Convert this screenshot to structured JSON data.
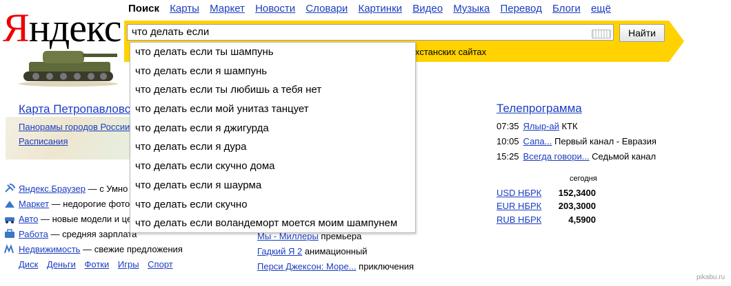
{
  "logo": {
    "first": "Я",
    "rest": "ндекс"
  },
  "nav": [
    "Поиск",
    "Карты",
    "Маркет",
    "Новости",
    "Словари",
    "Картинки",
    "Видео",
    "Музыка",
    "Перевод",
    "Блоги",
    "ещё"
  ],
  "search": {
    "value": "что делать если",
    "button": "Найти",
    "partial_hint": "хстанских сайтах"
  },
  "suggestions": [
    "что делать если ты шампунь",
    "что делать если я шампунь",
    "что делать если ты любишь а тебя нет",
    "что делать если мой унитаз танцует",
    "что делать если я джигурда",
    "что делать если я дура",
    "что делать если скучно дома",
    "что делать если я шаурма",
    "что делать если скучно",
    "что делать если воландеморт моется моим шампунем"
  ],
  "map": {
    "title": "Карта Петропавловс",
    "panoramas": "Панорамы городов России",
    "schedules": "Расписания"
  },
  "services": [
    {
      "icon": "browser-icon",
      "link": "Яндекс.Браузер",
      "text": "— с Умно"
    },
    {
      "icon": "market-icon",
      "link": "Маркет",
      "text": "— недорогие фото"
    },
    {
      "icon": "auto-icon",
      "link": "Авто",
      "text": "— новые модели и це"
    },
    {
      "icon": "job-icon",
      "link": "Работа",
      "text": "— средняя зарплата"
    },
    {
      "icon": "realty-icon",
      "link": "Недвижимость",
      "text": "— свежие предложения"
    }
  ],
  "footer_links": [
    "Диск",
    "Деньги",
    "Фотки",
    "Игры",
    "Спорт"
  ],
  "movies": [
    {
      "link": "Мы - Миллеры",
      "text": "премьера"
    },
    {
      "link": "Гадкий Я 2",
      "text": "анимационный"
    },
    {
      "link": "Перси Джексон: Море...",
      "text": "приключения"
    }
  ],
  "tv": {
    "title": "Телепрограмма",
    "items": [
      {
        "time": "07:35",
        "link": "Ялыр-ай",
        "channel": "КТК"
      },
      {
        "time": "10:05",
        "link": "Сапа...",
        "channel": "Первый канал - Евразия"
      },
      {
        "time": "15:25",
        "link": "Всегда говори...",
        "channel": "Седьмой канал"
      }
    ]
  },
  "currency": {
    "header": "сегодня",
    "rows": [
      {
        "name": "USD НБРК",
        "value": "152,3400"
      },
      {
        "name": "EUR НБРК",
        "value": "203,3000"
      },
      {
        "name": "RUB НБРК",
        "value": "4,5900"
      }
    ]
  },
  "watermark": "pikabu.ru",
  "colors": {
    "band": "#ffd200",
    "link": "#1a3dc1",
    "logo_red": "#ee0000"
  }
}
